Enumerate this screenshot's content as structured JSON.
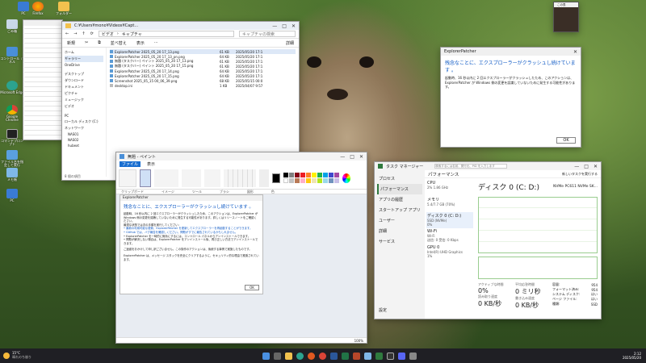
{
  "desktop": {
    "icons": [
      {
        "label": "ごみ箱"
      },
      {
        "label": "コントロール パネル"
      },
      {
        "label": "Microsoft Edge"
      },
      {
        "label": "Google Chrome"
      },
      {
        "label": "コマンドプロンプト"
      },
      {
        "label": "ファイル名を指定して実行"
      },
      {
        "label": "メモ帳"
      },
      {
        "label": "PC"
      }
    ],
    "top_icons": [
      {
        "label": "PC"
      },
      {
        "label": "Firefox"
      },
      {
        "label": "フォルダー"
      }
    ]
  },
  "explorer": {
    "path": "C:¥Users¥mono¥Videos¥Captures",
    "tab_title": "C:¥Users¥mono¥Videos¥Capt...",
    "breadcrumb": [
      "ビデオ",
      "キャプチャ"
    ],
    "search_placeholder": "キャプチャの検索",
    "toolbar": {
      "new": "新規",
      "sort": "並べ替え",
      "view": "表示",
      "details": "詳細"
    },
    "sidebar": [
      {
        "label": "ホーム"
      },
      {
        "label": "ギャラリー"
      },
      {
        "label": "OneDrive"
      },
      {
        "label": "デスクトップ"
      },
      {
        "label": "ダウンロード"
      },
      {
        "label": "ドキュメント"
      },
      {
        "label": "ピクチャ"
      },
      {
        "label": "ミュージック"
      },
      {
        "label": "ビデオ"
      },
      {
        "label": "PC"
      },
      {
        "label": "ローカル ディスク (C:)"
      },
      {
        "label": "ネットワーク"
      },
      {
        "label": "NAS01"
      },
      {
        "label": "NAS02"
      },
      {
        "label": "hubext"
      }
    ],
    "files": [
      {
        "name": "ExplorerPatcher 2025_05_20 17_13.png",
        "size": "61 KB",
        "date": "2025/05/20 17:1"
      },
      {
        "name": "ExplorerPatcher 2025_05_20 17_13_pn.png",
        "size": "64 KB",
        "date": "2025/05/20 17:1"
      },
      {
        "name": "無題 (タスクバー) ペイント 2025_05_20 17_13.png",
        "size": "61 KB",
        "date": "2025/05/20 17:1"
      },
      {
        "name": "無題 (タスクバー) ペイント 2025_05_20 17_15.png",
        "size": "61 KB",
        "date": "2025/05/20 17:1"
      },
      {
        "name": "ExplorerPatcher 2025_05_20 17_14.png",
        "size": "64 KB",
        "date": "2025/05/20 17:1"
      },
      {
        "name": "ExplorerPatcher 2025_05_20 17_15.png",
        "size": "64 KB",
        "date": "2025/05/20 17:1"
      },
      {
        "name": "Screenshot 2025_05_15 00_06_39.png",
        "size": "68 KB",
        "date": "2025/05/15 00:0"
      },
      {
        "name": "desktop.ini",
        "size": "1 KB",
        "date": "2025/04/07 9:57"
      }
    ],
    "status": "8 個の項目"
  },
  "paint": {
    "title": "無題 - ペイント",
    "menu": [
      "ファイル",
      "表示"
    ],
    "tool_groups": [
      "クリップボード",
      "イメージ",
      "ツール",
      "ブラシ",
      "図形",
      "色"
    ],
    "status_zoom": "100%",
    "palette": [
      "#000000",
      "#7f7f7f",
      "#880015",
      "#ed1c24",
      "#ff7f27",
      "#fff200",
      "#22b14c",
      "#00a2e8",
      "#3f48cc",
      "#a349a4",
      "#ffffff",
      "#c3c3c3",
      "#b97a57",
      "#ffaec9",
      "#ffc90e",
      "#efe4b0",
      "#b5e61d",
      "#99d9ea",
      "#7092be",
      "#c8bfe7"
    ]
  },
  "dialog": {
    "title": "ExplorerPatcher",
    "heading": "残念なことに、エクスプローラーがクラッシュし続けています 。",
    "p1": "起動時、16 秒以内に 2 回エクスプローラーがクラッシュしたため、このアクションは、ExplorerPatcher が Windows 側の変更を認識していないために発生する可能性があります。詳しくはリリースノートをご確認ください。",
    "p2": "最適な状態では次の手順を実行してください:",
    "b1": "• 最新の利用可能な更新、ExplorerPatcher を更新してエクスプローラーを再起動することができます。",
    "b2": "• GitHub では、バグ報告を確認しください。問題がすでに報告されているかもしれません。",
    "b3": "• ExplorerPatcher を一時的に無効にするには、コントロール パネルからアンインストールできます。",
    "b4": "• 問題が解決しない場合は、ExplorerPatcher をアンインストール後、再び正しい方法でアンインストールできます。",
    "p3": "ご迷惑をおかけして申し訳ございません。この操作のアクションは、後続する事情で実施したものです。",
    "p4": "ExplorerPatcher は、メッセージ スタックを完全にクリアするように、セキュリティ的な理由で推奨されています。",
    "ok": "OK"
  },
  "taskmgr": {
    "title": "タスク マネージャー",
    "search_placeholder": "検索するには名前、発行元、PID を入力します",
    "nav": [
      {
        "label": "プロセス"
      },
      {
        "label": "パフォーマンス"
      },
      {
        "label": "アプリの履歴"
      },
      {
        "label": "スタートアップ アプリ"
      },
      {
        "label": "ユーザー"
      },
      {
        "label": "詳細"
      },
      {
        "label": "サービス"
      }
    ],
    "settings": "設定",
    "header": "パフォーマンス",
    "run_task": "新しいタスクを実行する",
    "resources": [
      {
        "name": "CPU",
        "detail": "2%  1.86 GHz"
      },
      {
        "name": "メモリ",
        "detail": "5.4/7.7 GB (70%)"
      },
      {
        "name": "ディスク 0 (C: D:)",
        "detail": "SSD (NVMe)\n0%"
      },
      {
        "name": "Wi-Fi",
        "detail": "Wi-Fi\n送信: 0 受信: 0 Kbps"
      },
      {
        "name": "GPU 0",
        "detail": "Intel(R) UHD Graphics\n1%"
      }
    ],
    "disk_title": "ディスク 0 (C: D:)",
    "disk_model": "NVMe PC611 NVMe SK...",
    "stats": [
      {
        "label": "アクティブな時間",
        "value": "0%"
      },
      {
        "label": "平均応答時間",
        "value": "0 ミリ秒"
      },
      {
        "label": "読み取り速度",
        "value": "0 KB/秒"
      },
      {
        "label": "書き込み速度",
        "value": "0 KB/秒"
      }
    ],
    "side_stats": [
      {
        "label": "容量:",
        "value": "954"
      },
      {
        "label": "フォーマット済み:",
        "value": "954"
      },
      {
        "label": "システム ディスク:",
        "value": "はい"
      },
      {
        "label": "ページ ファイル:",
        "value": "はい"
      },
      {
        "label": "種類:",
        "value": "SSD"
      }
    ]
  },
  "right_dialog": {
    "title": "ExplorerPatcher",
    "heading": "残念なことに、エクスプローラーがクラッシュし続けています 。",
    "text": "起動時、16 秒以内に 2 回エクスプローラーがクラッシュしたため、このアクションは、ExplorerPatcher が Windows 側の変更を認識していないために発生する可能性があります。",
    "ok": "OK"
  },
  "mini_window": {
    "title": "この表"
  },
  "taskbar": {
    "weather_temp": "15°C",
    "weather_text": "晴れのち曇り",
    "time": "2:12",
    "date": "2025/05/20"
  }
}
